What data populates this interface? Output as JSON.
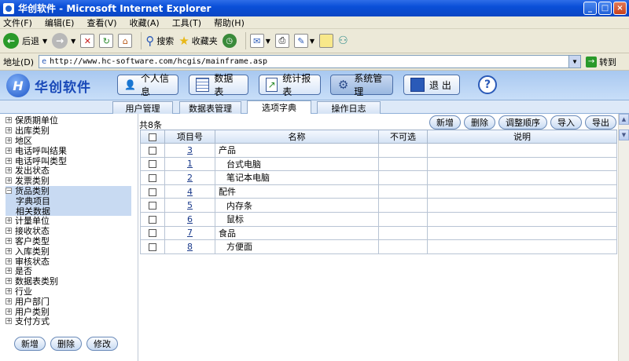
{
  "window": {
    "title": "华创软件 - Microsoft Internet Explorer"
  },
  "menu": [
    "文件(F)",
    "编辑(E)",
    "查看(V)",
    "收藏(A)",
    "工具(T)",
    "帮助(H)"
  ],
  "ie_toolbar": {
    "back": "后退",
    "search": "搜索",
    "favorites": "收藏夹"
  },
  "address": {
    "label": "地址(D)",
    "url": "http://www.hc-software.com/hcgis/mainframe.asp",
    "go": "转到"
  },
  "app": {
    "logo_text": "华创软件",
    "nav": [
      "个人信息",
      "数据表",
      "统计报表",
      "系统管理",
      "退 出"
    ],
    "active_nav": "系统管理",
    "help": "?"
  },
  "tabs": [
    "用户管理",
    "数据表管理",
    "选项字典",
    "操作日志"
  ],
  "active_tab": "选项字典",
  "tree": {
    "items": [
      "保质期单位",
      "出库类别",
      "地区",
      "电话呼叫结果",
      "电话呼叫类型",
      "发出状态",
      "发票类别",
      "货品类别",
      "计量单位",
      "接收状态",
      "客户类型",
      "入库类别",
      "审核状态",
      "是否",
      "数据表类别",
      "行业",
      "用户部门",
      "用户类别",
      "支付方式"
    ],
    "expanded": "货品类别",
    "children": [
      "字典项目",
      "相关数据"
    ],
    "expand_symbol": "⊞",
    "collapse_symbol": "⊟"
  },
  "left_buttons": [
    "新增",
    "删除",
    "修改"
  ],
  "main": {
    "count_text": "共8条",
    "buttons": [
      "新增",
      "删除",
      "调整顺序",
      "导入",
      "导出"
    ],
    "columns": [
      "项目号",
      "名称",
      "不可选",
      "说明"
    ],
    "rows": [
      {
        "id": "3",
        "name": "产品",
        "level": 0
      },
      {
        "id": "1",
        "name": "台式电脑",
        "level": 1
      },
      {
        "id": "2",
        "name": "笔记本电脑",
        "level": 1
      },
      {
        "id": "4",
        "name": "配件",
        "level": 0
      },
      {
        "id": "5",
        "name": "内存条",
        "level": 1
      },
      {
        "id": "6",
        "name": "鼠标",
        "level": 1
      },
      {
        "id": "7",
        "name": "食品",
        "level": 0
      },
      {
        "id": "8",
        "name": "方便面",
        "level": 1
      }
    ]
  }
}
